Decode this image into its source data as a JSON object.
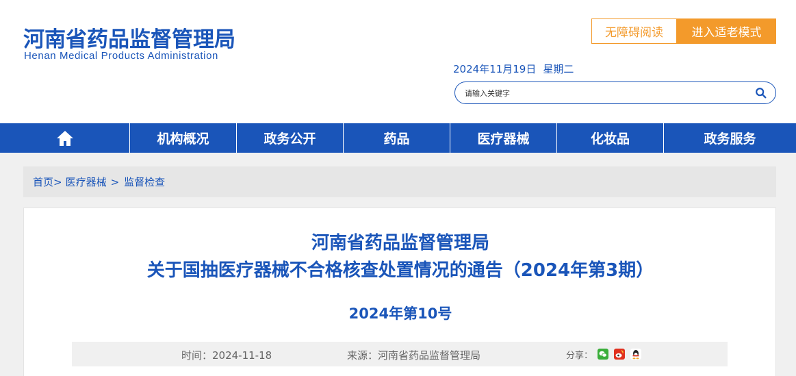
{
  "header": {
    "logo_cn": "河南省药品监督管理局",
    "logo_en": "Henan Medical Products Administration",
    "btn_accessible": "无障碍阅读",
    "btn_elder": "进入适老模式",
    "date": "2024年11月19日",
    "weekday": "星期二",
    "search_placeholder": "请输入关键字"
  },
  "nav": {
    "items": [
      "机构概况",
      "政务公开",
      "药品",
      "医疗器械",
      "化妆品",
      "政务服务"
    ]
  },
  "breadcrumb": {
    "home": "首页>",
    "level1": "医疗器械",
    "sep": ">",
    "level2": "监督检查"
  },
  "article": {
    "title_line1": "河南省药品监督管理局",
    "title_line2": "关于国抽医疗器械不合格核查处置情况的通告（2024年第3期）",
    "doc_no": "2024年第10号",
    "time": "时间：2024-11-18",
    "source": "来源：河南省药品监督管理局",
    "share": "分享："
  },
  "colors": {
    "brand_blue": "#1a55b9",
    "accent_orange": "#f39a2b"
  }
}
